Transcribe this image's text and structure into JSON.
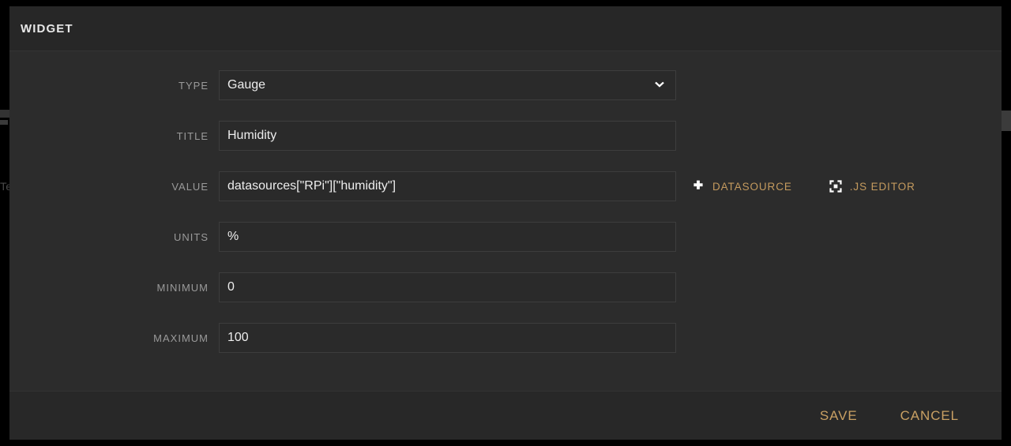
{
  "background": {
    "fragment_text": "Te"
  },
  "dialog": {
    "title": "WIDGET",
    "fields": [
      {
        "label": "TYPE",
        "kind": "select",
        "value": "Gauge",
        "icon": "chevron-down-icon"
      },
      {
        "label": "TITLE",
        "kind": "text",
        "value": "Humidity"
      },
      {
        "label": "VALUE",
        "kind": "text",
        "value_prefix": "datasources[\"",
        "value_misspelled": "RPi",
        "value_suffix": "\"][\"humidity\"]",
        "value": "datasources[\"RPi\"][\"humidity\"]"
      },
      {
        "label": "UNITS",
        "kind": "text",
        "value": "%"
      },
      {
        "label": "MINIMUM",
        "kind": "text",
        "value": "0"
      },
      {
        "label": "MAXIMUM",
        "kind": "text",
        "value": "100"
      }
    ],
    "value_actions": [
      {
        "icon": "plus-icon",
        "label": "DATASOURCE"
      },
      {
        "icon": "expand-icon",
        "label": ".JS EDITOR"
      }
    ],
    "footer": {
      "save_label": "SAVE",
      "cancel_label": "CANCEL"
    }
  },
  "colors": {
    "accent": "#c49a5e",
    "footer_accent": "#c9a063",
    "dialog_bg": "#2c2c2c",
    "header_bg": "#272727",
    "field_bg": "#2a2a2a",
    "field_border": "#3d3d3d",
    "label_text": "#9a9a9a",
    "value_text": "#ededed",
    "spellcheck": "#e03636"
  }
}
